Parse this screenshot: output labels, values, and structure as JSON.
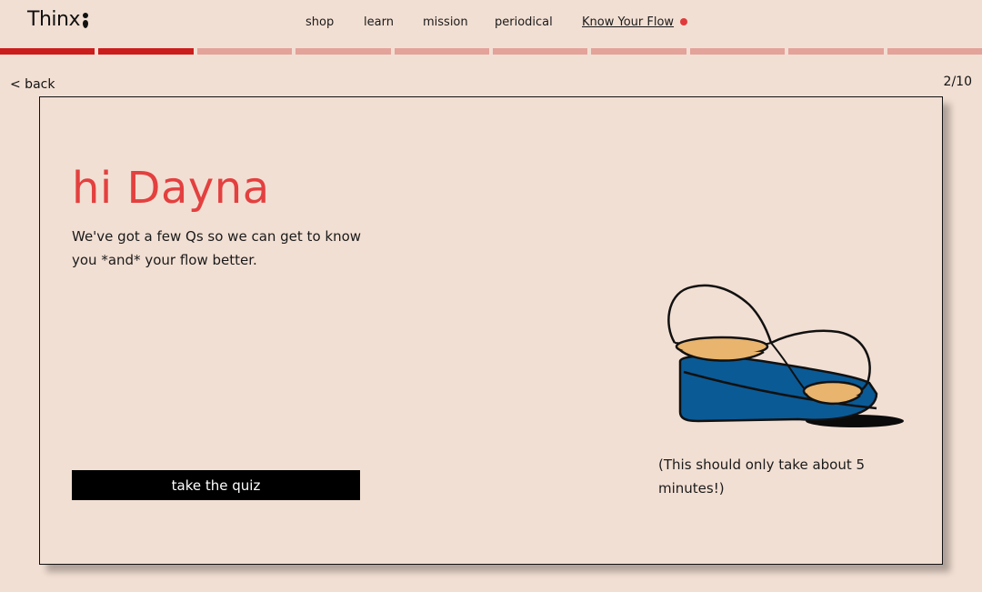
{
  "brand": {
    "logo_text": "Thinx"
  },
  "nav": {
    "shop": "shop",
    "learn": "learn",
    "mission": "mission",
    "periodical": "periodical",
    "know_your_flow": "Know Your Flow"
  },
  "progress": {
    "total_segments": 10,
    "completed_segments": 2,
    "completed_color": "#cc1d1d",
    "remaining_color": "#e3a29a"
  },
  "back_label": "< back",
  "step_indicator": "2/10",
  "card": {
    "greeting": "hi Dayna",
    "intro": "We've got a few Qs so we can get to know you *and* your flow better.",
    "cta_label": "take the quiz",
    "note": "(This should only take about 5 minutes!)",
    "illustration": "hourglass-icon"
  },
  "colors": {
    "background": "#f2dfd3",
    "accent": "#e3403f",
    "button": "#000000",
    "illustration_blue": "#0a5a96",
    "illustration_sand": "#e8b46e"
  }
}
